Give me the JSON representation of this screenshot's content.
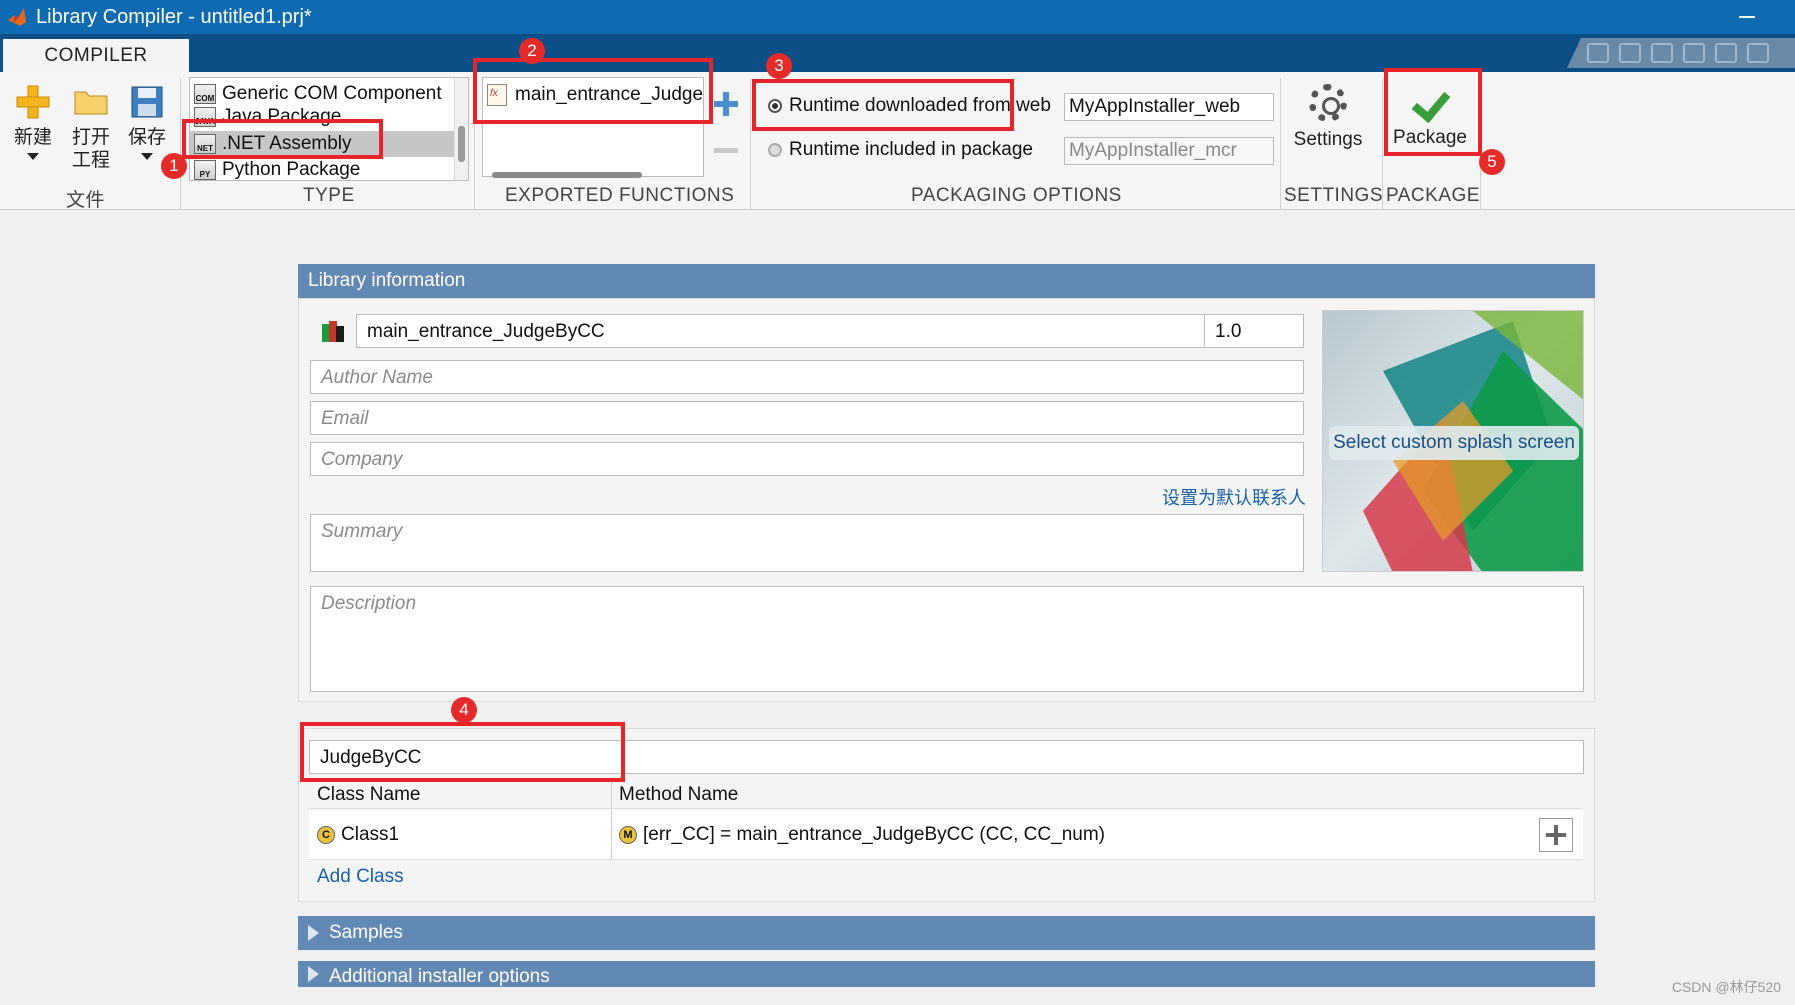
{
  "window": {
    "title": "Library Compiler - untitled1.prj*"
  },
  "ribbon": {
    "tab": "COMPILER",
    "file": {
      "new_label": "新建",
      "open_label_1": "打开",
      "open_label_2": "工程",
      "save_label": "保存",
      "section": "文件"
    },
    "type": {
      "section": "TYPE",
      "items": [
        {
          "label": "Generic COM Component",
          "icon": "COM"
        },
        {
          "label": "Java Package",
          "icon": "JAVA"
        },
        {
          "label": ".NET Assembly",
          "icon": "NET",
          "selected": true
        },
        {
          "label": "Python Package",
          "icon": "PY"
        }
      ]
    },
    "exported": {
      "section": "EXPORTED FUNCTIONS",
      "function": "main_entrance_JudgeByCC"
    },
    "packaging": {
      "section": "PACKAGING OPTIONS",
      "radio_web": "Runtime downloaded from web",
      "web_value": "MyAppInstaller_web",
      "radio_included": "Runtime included in package",
      "mcr_value": "MyAppInstaller_mcr"
    },
    "settings": {
      "label": "Settings",
      "section": "SETTINGS"
    },
    "package": {
      "label": "Package",
      "section": "PACKAGE"
    }
  },
  "library_info": {
    "header": "Library information",
    "name": "main_entrance_JudgeByCC",
    "version": "1.0",
    "author_placeholder": "Author Name",
    "email_placeholder": "Email",
    "company_placeholder": "Company",
    "default_contact_link": "设置为默认联系人",
    "summary_placeholder": "Summary",
    "description_placeholder": "Description",
    "splash_button": "Select custom splash screen"
  },
  "class_map": {
    "namespace": "JudgeByCC",
    "col_class": "Class Name",
    "col_method": "Method Name",
    "rows": [
      {
        "class": "Class1",
        "method": "[err_CC] = main_entrance_JudgeByCC (CC, CC_num)"
      }
    ],
    "add_class": "Add Class"
  },
  "sections": {
    "samples": "Samples",
    "additional": "Additional installer options"
  },
  "annotations": [
    "1",
    "2",
    "3",
    "4",
    "5"
  ],
  "watermark": "CSDN @林仔520",
  "colors": {
    "title_bar": "#0e6ab1",
    "panel_header": "#6289b3",
    "annotation_red": "#e8242b"
  }
}
